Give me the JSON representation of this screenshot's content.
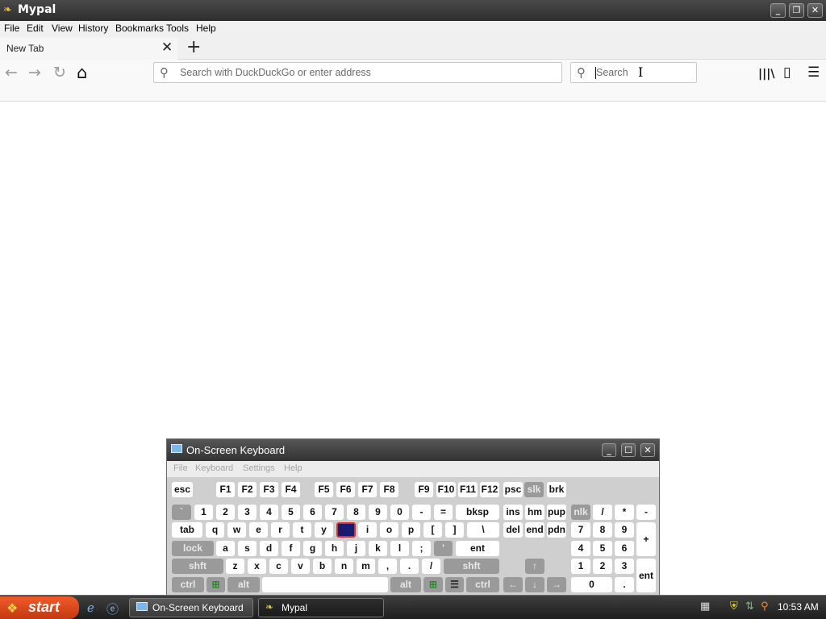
{
  "window": {
    "title": "Mypal",
    "minimize": "_",
    "restore": "❐",
    "close": "✕"
  },
  "menu": [
    "File",
    "Edit",
    "View",
    "History",
    "Bookmarks",
    "Tools",
    "Help"
  ],
  "tab": {
    "label": "New Tab",
    "close": "✕",
    "new_tab": "+"
  },
  "nav": {
    "back": "←",
    "forward": "→",
    "reload": "↻",
    "home": "⌂",
    "url_placeholder": "Search with DuckDuckGo or enter address",
    "search_placeholder": "Search",
    "library": "|||\\",
    "sidebar": "▯",
    "menu": "☰",
    "magnifier": "⚲"
  },
  "osk": {
    "title": "On-Screen Keyboard",
    "menu": [
      "File",
      "Keyboard",
      "Settings",
      "Help"
    ],
    "row_function": [
      "esc",
      "F1",
      "F2",
      "F3",
      "F4",
      "F5",
      "F6",
      "F7",
      "F8",
      "F9",
      "F10",
      "F11",
      "F12",
      "psc",
      "slk",
      "brk"
    ],
    "row_number": [
      "`",
      "1",
      "2",
      "3",
      "4",
      "5",
      "6",
      "7",
      "8",
      "9",
      "0",
      "-",
      "=",
      "bksp",
      "ins",
      "hm",
      "pup",
      "nlk",
      "/",
      "*",
      "-"
    ],
    "row_tab": [
      "tab",
      "q",
      "w",
      "e",
      "r",
      "t",
      "y",
      "",
      "i",
      "o",
      "p",
      "[",
      "]",
      "\\",
      "del",
      "end",
      "pdn",
      "7",
      "8",
      "9",
      "+"
    ],
    "row_caps": [
      "lock",
      "a",
      "s",
      "d",
      "f",
      "g",
      "h",
      "j",
      "k",
      "l",
      ";",
      "'",
      "ent",
      "4",
      "5",
      "6"
    ],
    "row_shift": [
      "shft",
      "z",
      "x",
      "c",
      "v",
      "b",
      "n",
      "m",
      ",",
      ".",
      "/",
      "shft",
      "↑",
      "1",
      "2",
      "3",
      "ent"
    ],
    "row_ctrl": [
      "ctrl",
      "⊞",
      "alt",
      "",
      "alt",
      "⊞",
      "☰",
      "ctrl",
      "←",
      "↓",
      "→",
      "0",
      "."
    ]
  },
  "taskbar": {
    "start": "start",
    "tasks": [
      "On-Screen Keyboard",
      "Mypal"
    ],
    "clock": "10:53 AM"
  },
  "colors": {
    "titlebar": "#2d2d2d",
    "start": "#d9461b",
    "osk_highlight": "#1a1a6e",
    "highlight_border": "#d23232"
  }
}
